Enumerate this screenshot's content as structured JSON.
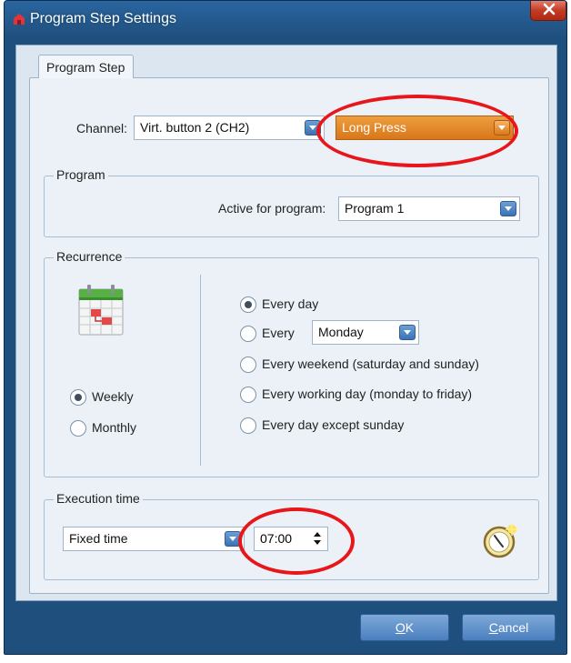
{
  "window": {
    "title": "Program Step Settings"
  },
  "tab": {
    "label": "Program Step"
  },
  "channel": {
    "label": "Channel:",
    "value": "Virt. button 2 (CH2)",
    "action_value": "Long Press"
  },
  "program_group": {
    "title": "Program",
    "active_label": "Active for program:",
    "active_value": "Program 1"
  },
  "recurrence": {
    "title": "Recurrence",
    "modes": [
      {
        "label": "Weekly",
        "checked": true
      },
      {
        "label": "Monthly",
        "checked": false
      }
    ],
    "options": [
      {
        "label": "Every day",
        "checked": true
      },
      {
        "label": "Every",
        "checked": false
      },
      {
        "label": "Every weekend (saturday and sunday)",
        "checked": false
      },
      {
        "label": "Every working day (monday to friday)",
        "checked": false
      },
      {
        "label": "Every day except sunday",
        "checked": false
      }
    ],
    "weekday_value": "Monday"
  },
  "execution": {
    "title": "Execution time",
    "type_value": "Fixed time",
    "time_value": "07:00"
  },
  "buttons": {
    "ok_label": "OK",
    "ok_mnemonic": "O",
    "ok_rest": "K",
    "cancel_label": "Cancel",
    "cancel_mnemonic": "C",
    "cancel_rest": "ancel"
  },
  "colors": {
    "title_bar": "#1f4f7d",
    "highlight_orange": "#e08a2a",
    "annotation_red": "#e8161b",
    "panel": "#ebf1f7"
  },
  "icons": {
    "app": "app-icon",
    "close": "close-icon",
    "calendar": "calendar-icon",
    "clock": "clock-icon"
  }
}
